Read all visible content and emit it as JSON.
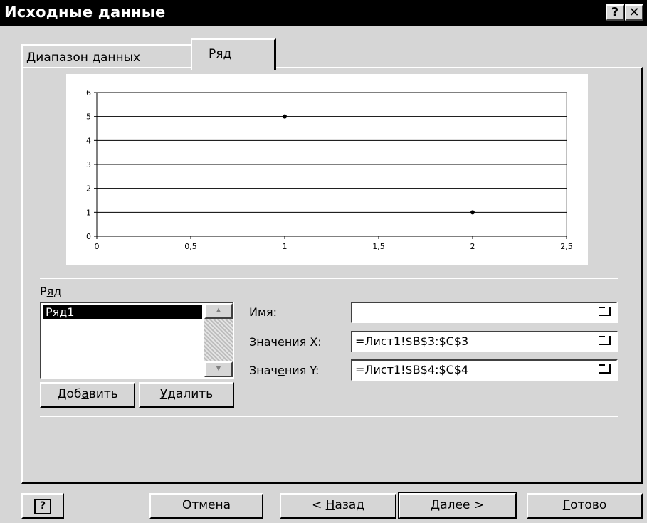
{
  "window": {
    "title": "Исходные данные",
    "help_glyph": "?",
    "close_glyph": "✕"
  },
  "tabs": [
    {
      "label": "Диапазон данных"
    },
    {
      "label": "Ряд"
    }
  ],
  "chart_data": {
    "type": "scatter",
    "title": "",
    "xlabel": "",
    "ylabel": "",
    "xlim": [
      0,
      2.5
    ],
    "ylim": [
      0,
      6
    ],
    "x_ticks": [
      "0",
      "0,5",
      "1",
      "1,5",
      "2",
      "2,5"
    ],
    "y_ticks": [
      "0",
      "1",
      "2",
      "3",
      "4",
      "5",
      "6"
    ],
    "grid": "horizontal",
    "legend": "none",
    "series": [
      {
        "x": [
          1,
          2
        ],
        "y": [
          5,
          1
        ]
      }
    ]
  },
  "series_panel": {
    "list_label_pre": "Р",
    "list_label_u": "я",
    "list_label_post": "д",
    "items": [
      "Ряд1"
    ],
    "add_pre": "Доб",
    "add_u": "а",
    "add_post": "вить",
    "remove_u": "У",
    "remove_post": "далить"
  },
  "fields": {
    "name_u": "И",
    "name_post": "мя:",
    "name_value": "",
    "x_pre": "Зна",
    "x_u": "ч",
    "x_post": "ения X:",
    "x_value": "=Лист1!$B$3:$C$3",
    "y_pre": "Знач",
    "y_u": "е",
    "y_post": "ния Y:",
    "y_value": "=Лист1!$B$4:$C$4"
  },
  "footer": {
    "help_glyph": "?",
    "cancel": "Отмена",
    "back_pre": "< ",
    "back_u": "Н",
    "back_post": "азад",
    "next": "Далее >",
    "finish_u": "Г",
    "finish_post": "отово"
  },
  "colors": {
    "title_bar": "#000000",
    "dialog_bg": "#d6d6d6",
    "chart_bg": "#ffffff"
  }
}
